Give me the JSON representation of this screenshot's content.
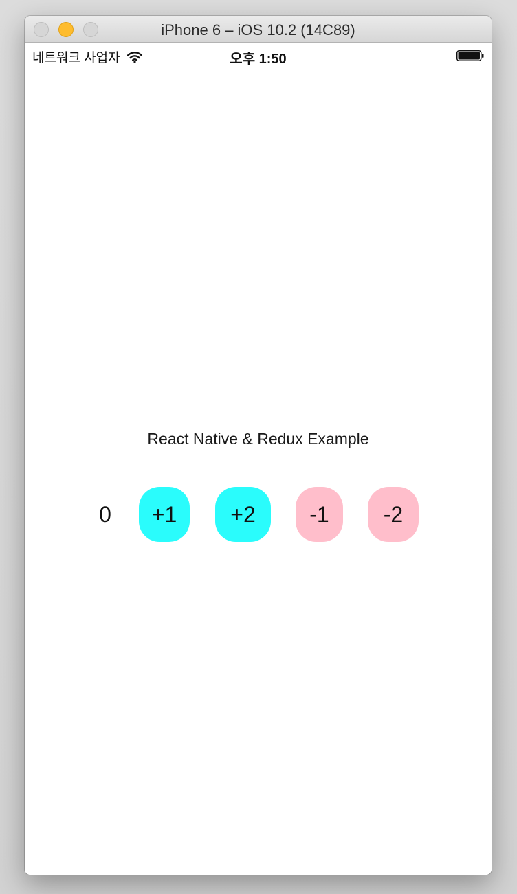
{
  "window": {
    "title": "iPhone 6 – iOS 10.2 (14C89)"
  },
  "statusbar": {
    "carrier": "네트워크 사업자",
    "time": "오후 1:50",
    "wifi_icon": "wifi-icon",
    "battery_icon": "battery-full-icon"
  },
  "app": {
    "title": "React Native & Redux Example",
    "count": "0",
    "buttons": {
      "plus_one": "+1",
      "plus_two": "+2",
      "minus_one": "-1",
      "minus_two": "-2"
    },
    "colors": {
      "increment": "#2afcfc",
      "decrement": "#ffbecb"
    }
  }
}
